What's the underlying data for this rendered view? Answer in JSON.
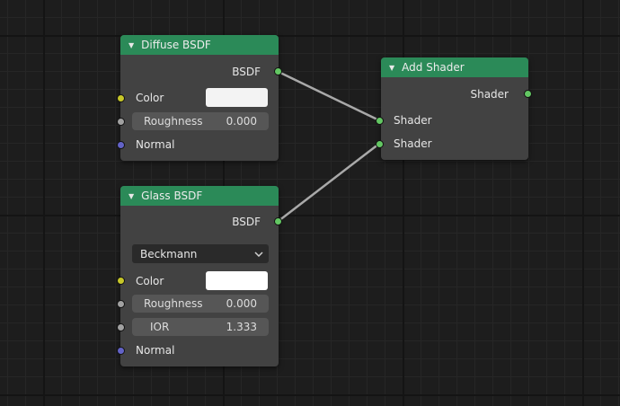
{
  "colors": {
    "header": "#2b8a58",
    "shader_socket": "#63c763",
    "color_socket": "#c7c729",
    "value_socket": "#a1a1a1",
    "vector_socket": "#6363c7"
  },
  "nodes": {
    "diffuse": {
      "title": "Diffuse BSDF",
      "output": "BSDF",
      "color_label": "Color",
      "roughness_label": "Roughness",
      "roughness_value": "0.000",
      "normal_label": "Normal"
    },
    "glass": {
      "title": "Glass BSDF",
      "output": "BSDF",
      "distribution": "Beckmann",
      "color_label": "Color",
      "roughness_label": "Roughness",
      "roughness_value": "0.000",
      "ior_label": "IOR",
      "ior_value": "1.333",
      "normal_label": "Normal"
    },
    "add_shader": {
      "title": "Add Shader",
      "output": "Shader",
      "input1": "Shader",
      "input2": "Shader"
    }
  }
}
